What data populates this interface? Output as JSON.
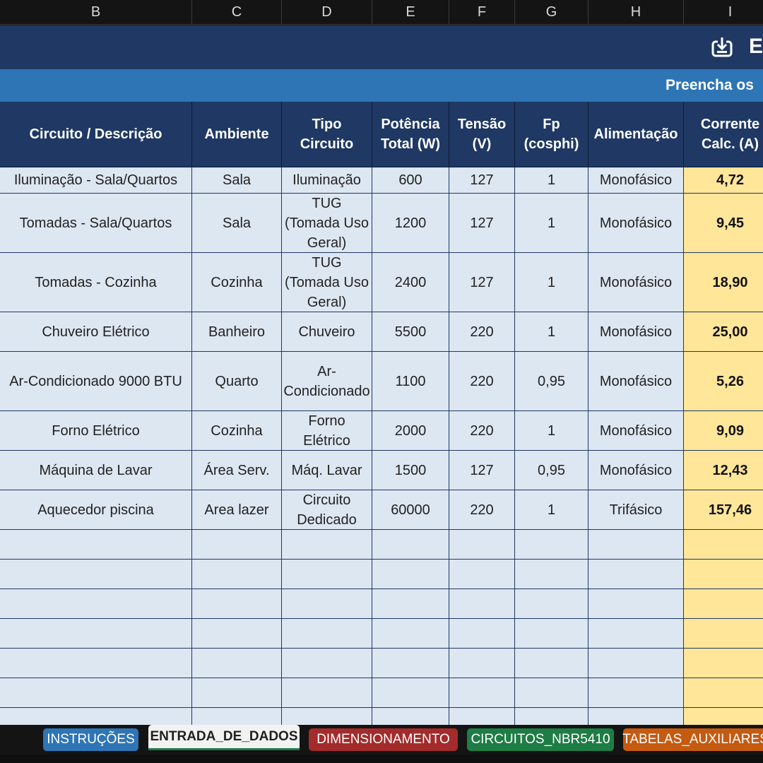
{
  "columns": [
    "B",
    "C",
    "D",
    "E",
    "F",
    "G",
    "H",
    "I"
  ],
  "title": {
    "text": "E",
    "icon": "export-icon"
  },
  "subtitle": "Preencha os",
  "table": {
    "headers": [
      "Circuito / Descrição",
      "Ambiente",
      "Tipo Circuito",
      "Potência Total (W)",
      "Tensão (V)",
      "Fp (cosphi)",
      "Alimentação",
      "Corrente Calc. (A)"
    ],
    "rows": [
      [
        "Iluminação - Sala/Quartos",
        "Sala",
        "Iluminação",
        "600",
        "127",
        "1",
        "Monofásico",
        "4,72"
      ],
      [
        "Tomadas - Sala/Quartos",
        "Sala",
        "TUG (Tomada Uso Geral)",
        "1200",
        "127",
        "1",
        "Monofásico",
        "9,45"
      ],
      [
        "Tomadas - Cozinha",
        "Cozinha",
        "TUG (Tomada Uso Geral)",
        "2400",
        "127",
        "1",
        "Monofásico",
        "18,90"
      ],
      [
        "Chuveiro Elétrico",
        "Banheiro",
        "Chuveiro",
        "5500",
        "220",
        "1",
        "Monofásico",
        "25,00"
      ],
      [
        "Ar-Condicionado 9000 BTU",
        "Quarto",
        "Ar-Condicionado",
        "1100",
        "220",
        "0,95",
        "Monofásico",
        "5,26"
      ],
      [
        "Forno Elétrico",
        "Cozinha",
        "Forno Elétrico",
        "2000",
        "220",
        "1",
        "Monofásico",
        "9,09"
      ],
      [
        "Máquina de Lavar",
        "Área Serv.",
        "Máq. Lavar",
        "1500",
        "127",
        "0,95",
        "Monofásico",
        "12,43"
      ],
      [
        "Aquecedor piscina",
        "Area lazer",
        "Circuito Dedicado",
        "60000",
        "220",
        "1",
        "Trifásico",
        "157,46"
      ]
    ]
  },
  "sheet_tabs": [
    {
      "label": "INSTRUÇÕES",
      "color": "#2e75b6"
    },
    {
      "label": "ENTRADA_DE_DADOS",
      "color": "#f2f2f2",
      "active": true
    },
    {
      "label": "DIMENSIONAMENTO",
      "color": "#a32b2b"
    },
    {
      "label": "CIRCUITOS_NBR5410",
      "color": "#1e7d45"
    },
    {
      "label": "TABELAS_AUXILIARES",
      "color": "#c55a11"
    }
  ]
}
